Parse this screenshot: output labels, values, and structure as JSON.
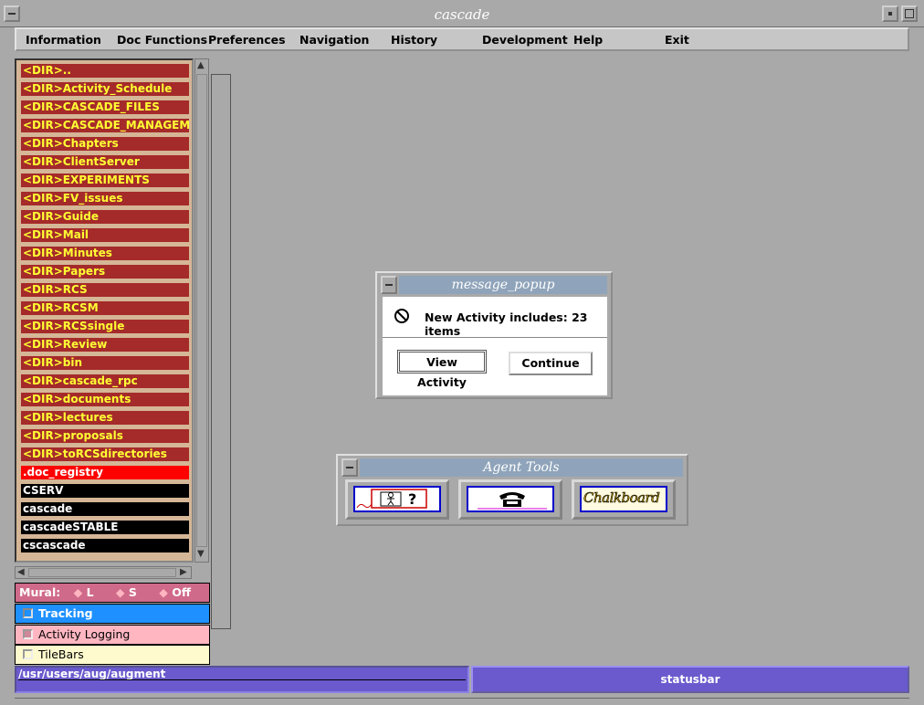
{
  "window": {
    "title": "cascade"
  },
  "menu": [
    "Information",
    "Doc Functions",
    "Preferences",
    "Navigation",
    "History",
    "Development",
    "Help",
    "Exit"
  ],
  "directory": [
    {
      "label": "<DIR>..",
      "kind": "dir"
    },
    {
      "label": "<DIR>Activity_Schedule",
      "kind": "dir"
    },
    {
      "label": "<DIR>CASCADE_FILES",
      "kind": "dir"
    },
    {
      "label": "<DIR>CASCADE_MANAGEMEN",
      "kind": "dir"
    },
    {
      "label": "<DIR>Chapters",
      "kind": "dir"
    },
    {
      "label": "<DIR>ClientServer",
      "kind": "dir"
    },
    {
      "label": "<DIR>EXPERIMENTS",
      "kind": "dir"
    },
    {
      "label": "<DIR>FV_issues",
      "kind": "dir"
    },
    {
      "label": "<DIR>Guide",
      "kind": "dir"
    },
    {
      "label": "<DIR>Mail",
      "kind": "dir"
    },
    {
      "label": "<DIR>Minutes",
      "kind": "dir"
    },
    {
      "label": "<DIR>Papers",
      "kind": "dir"
    },
    {
      "label": "<DIR>RCS",
      "kind": "dir"
    },
    {
      "label": "<DIR>RCSM",
      "kind": "dir"
    },
    {
      "label": "<DIR>RCSsingle",
      "kind": "dir"
    },
    {
      "label": "<DIR>Review",
      "kind": "dir"
    },
    {
      "label": "<DIR>bin",
      "kind": "dir"
    },
    {
      "label": "<DIR>cascade_rpc",
      "kind": "dir"
    },
    {
      "label": "<DIR>documents",
      "kind": "dir"
    },
    {
      "label": "<DIR>lectures",
      "kind": "dir"
    },
    {
      "label": "<DIR>proposals",
      "kind": "dir"
    },
    {
      "label": "<DIR>toRCSdirectories",
      "kind": "dir"
    },
    {
      "label": ".doc_registry",
      "kind": "sel"
    },
    {
      "label": "CSERV",
      "kind": "file"
    },
    {
      "label": "cascade",
      "kind": "file"
    },
    {
      "label": "cascadeSTABLE",
      "kind": "file"
    },
    {
      "label": "cscascade",
      "kind": "file"
    }
  ],
  "mural": {
    "label": "Mural:",
    "options": [
      "L",
      "S",
      "Off"
    ]
  },
  "options": {
    "tracking": "Tracking",
    "activity_logging": "Activity Logging",
    "tilebars": "TileBars"
  },
  "status": {
    "path": "/usr/users/aug/augment",
    "statusbar": "statusbar"
  },
  "popup": {
    "title": "message_popup",
    "message": "New Activity includes: 23 items",
    "view_button": "View Activity",
    "continue_button": "Continue"
  },
  "agent_tools": {
    "title": "Agent Tools",
    "chalkboard": "Chalkboard"
  },
  "colors": {
    "dir_bg": "#a52a2a",
    "dir_text": "#ffff33",
    "selected_bg": "#ff0000",
    "file_bg": "#000000",
    "statusbar_bg": "#6a5acd",
    "mural_bg": "#d06a8a",
    "tracking_bg": "#1e90ff",
    "activity_bg": "#ffb6c1",
    "tilebars_bg": "#fffacd"
  },
  "icons": [
    "window-menu-icon",
    "minimize-icon",
    "maximize-icon",
    "stop-icon",
    "person-help-icon",
    "telephone-icon"
  ]
}
